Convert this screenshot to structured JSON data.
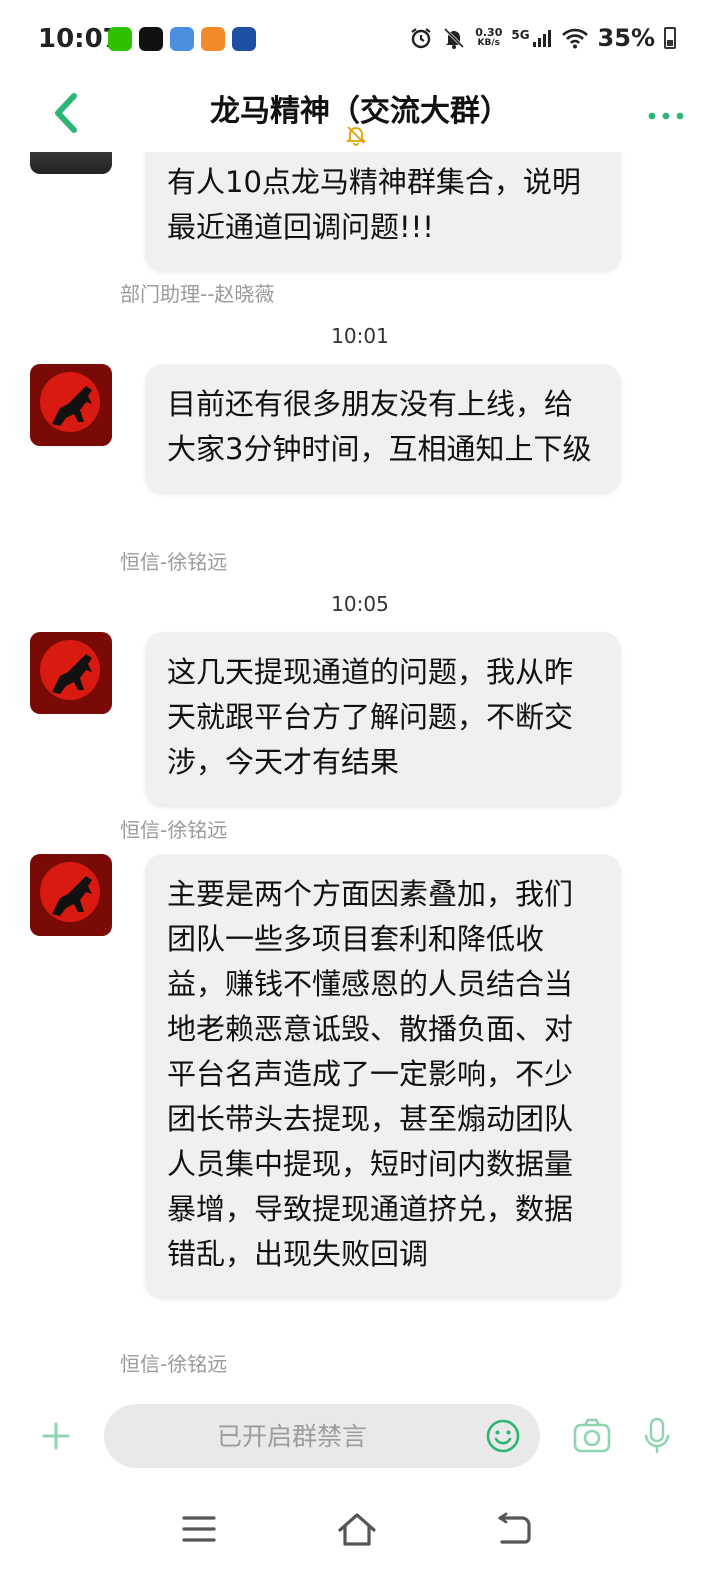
{
  "status_bar": {
    "time": "10:07",
    "net_speed_value": "0.30",
    "net_speed_unit": "KB/s",
    "network": "5G",
    "battery": "35%"
  },
  "header": {
    "title": "龙马精神（交流大群）"
  },
  "messages": {
    "m0": {
      "text": "有人10点龙马精神群集合，说明最近通道回调问题!!!",
      "sender": "部门助理--赵晓薇"
    },
    "t1": "10:01",
    "m1": {
      "text": "目前还有很多朋友没有上线，给大家3分钟时间，互相通知上下级",
      "sender": "恒信-徐铭远"
    },
    "t2": "10:05",
    "m2": {
      "text": "这几天提现通道的问题，我从昨天就跟平台方了解问题，不断交涉，今天才有结果",
      "sender": "恒信-徐铭远"
    },
    "m3": {
      "text": "主要是两个方面因素叠加，我们团队一些多项目套利和降低收益，赚钱不懂感恩的人员结合当地老赖恶意诋毁、散播负面、对平台名声造成了一定影响，不少团长带头去提现，甚至煽动团队人员集中提现，短时间内数据量暴增，导致提现通道挤兑，数据错乱，出现失败回调",
      "sender": "恒信-徐铭远"
    }
  },
  "input": {
    "placeholder": "已开启群禁言"
  },
  "colors": {
    "accent_green": "#2bb673",
    "bubble_bg": "#f0f0f3",
    "avatar_red": "#c4160f"
  }
}
